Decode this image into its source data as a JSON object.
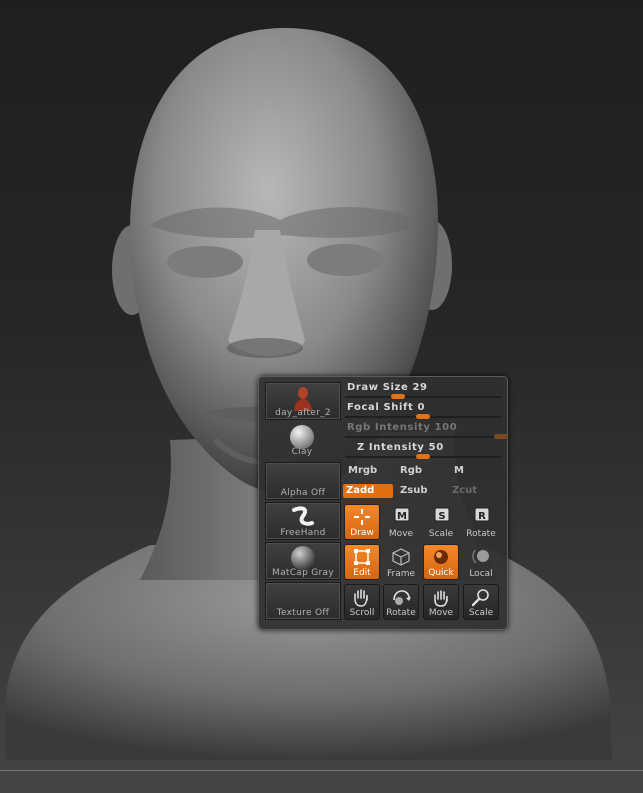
{
  "viewport": {
    "name": "ZBrush 3D canvas"
  },
  "tiles": [
    {
      "label": "day_after_2",
      "icon": "bust-thumbnail-icon"
    },
    {
      "label": "Clay",
      "icon": "clay-sphere-icon"
    },
    {
      "label": "Alpha Off",
      "icon": ""
    },
    {
      "label": "FreeHand",
      "icon": "freehand-stroke-icon"
    },
    {
      "label": "MatCap Gray",
      "icon": "matcap-sphere-icon"
    },
    {
      "label": "Texture Off",
      "icon": ""
    }
  ],
  "sliders": {
    "draw_size": {
      "label": "Draw Size",
      "value": "29",
      "fraction": 0.34
    },
    "focal_shift": {
      "label": "Focal Shift",
      "value": "0",
      "fraction": 0.5
    },
    "rgb_intensity": {
      "label": "Rgb Intensity",
      "value": "100",
      "fraction": 1.0,
      "disabled": true
    },
    "z_intensity": {
      "label": "Z Intensity",
      "value": "50",
      "fraction": 0.5
    }
  },
  "modes": {
    "mrgb": "Mrgb",
    "rgb": "Rgb",
    "m": "M",
    "zadd": "Zadd",
    "zsub": "Zsub",
    "zcut": "Zcut"
  },
  "buttons": {
    "draw": "Draw",
    "move": "Move",
    "scale": "Scale",
    "rotate": "Rotate",
    "edit": "Edit",
    "frame": "Frame",
    "quick": "Quick",
    "local": "Local",
    "scroll": "Scroll",
    "rotate2": "Rotate",
    "move2": "Move",
    "scale2": "Scale",
    "move_key": "M",
    "scale_key": "S",
    "rotate_key": "R"
  },
  "colors": {
    "accent": "#e36e10",
    "panel": "#303030"
  }
}
